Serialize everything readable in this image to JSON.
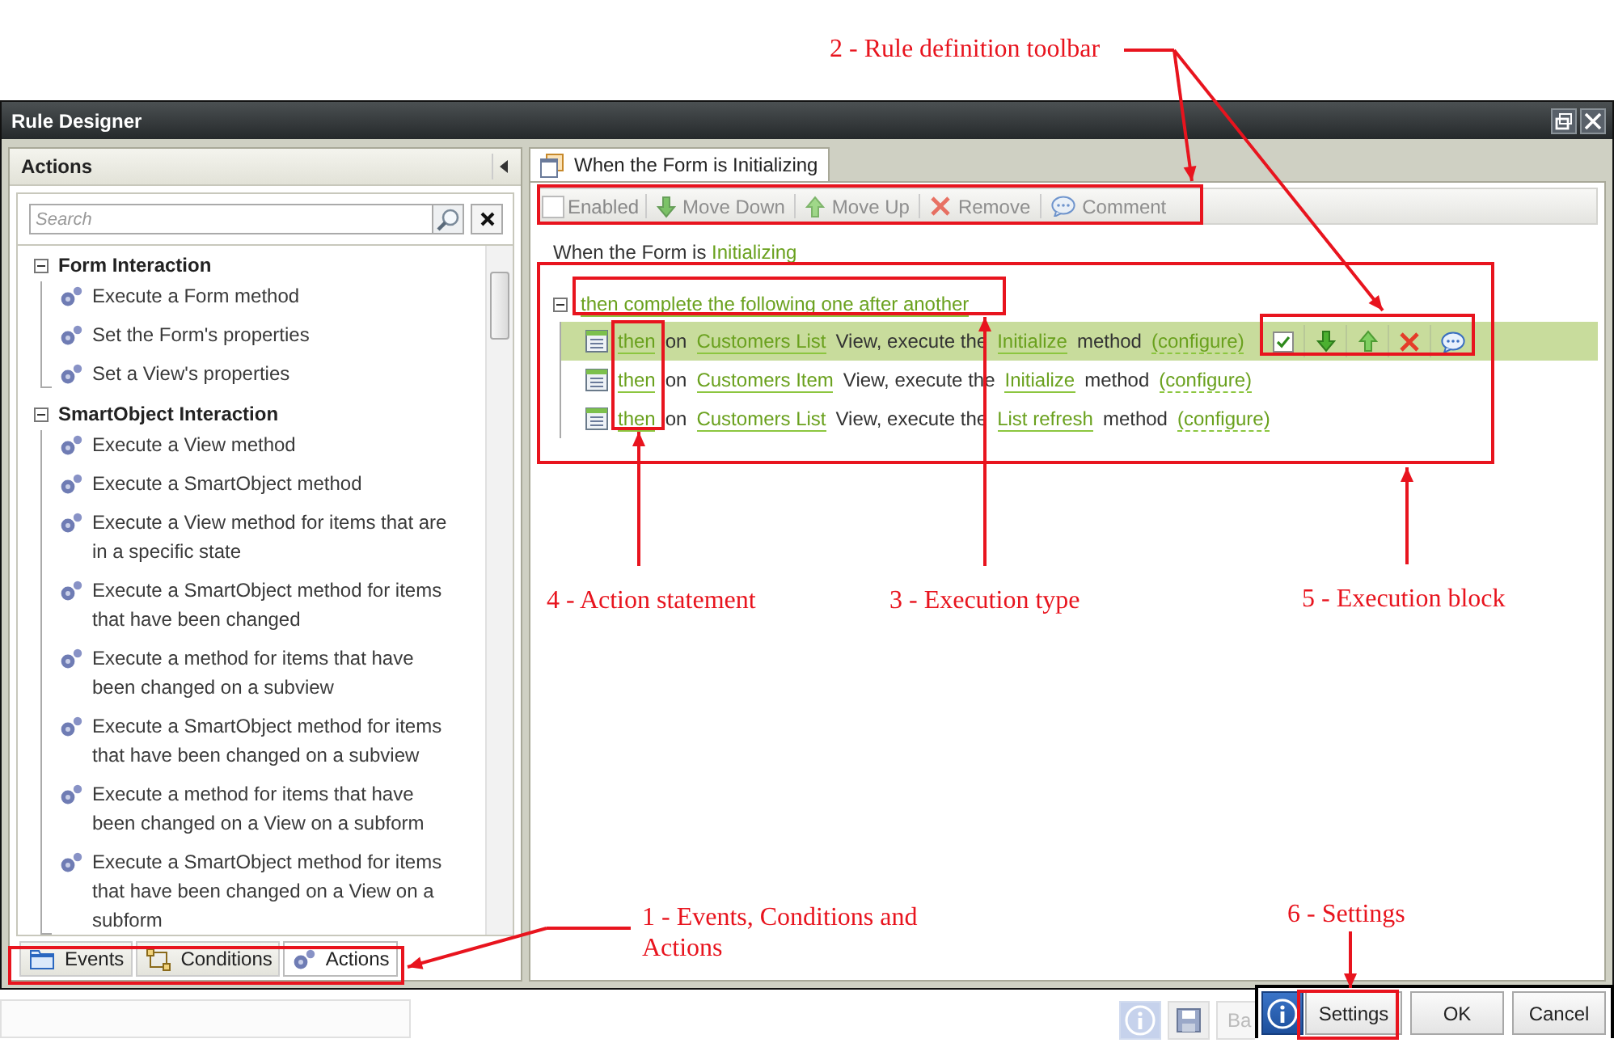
{
  "window": {
    "title": "Rule Designer"
  },
  "left_panel": {
    "title": "Actions",
    "search": {
      "placeholder": "Search"
    },
    "groups": [
      {
        "label": "Form Interaction",
        "expanded": true,
        "children": [
          {
            "label": "Execute a Form method"
          },
          {
            "label": "Set the Form's properties"
          },
          {
            "label": "Set a View's properties"
          }
        ]
      },
      {
        "label": "SmartObject Interaction",
        "expanded": true,
        "children": [
          {
            "label": "Execute a View method"
          },
          {
            "label": "Execute a SmartObject method"
          },
          {
            "label": "Execute a View method for items that are in a specific state"
          },
          {
            "label": "Execute a SmartObject method for items that have been changed"
          },
          {
            "label": "Execute a method for items that have been changed on a subview"
          },
          {
            "label": "Execute a SmartObject method for items that have been changed on a subview"
          },
          {
            "label": "Execute a method for items that have been changed on a View on a subform"
          },
          {
            "label": "Execute a SmartObject method for items that have been changed on a View on a subform"
          }
        ]
      }
    ],
    "tabs": [
      {
        "label": "Events",
        "kind": "events",
        "selected": false
      },
      {
        "label": "Conditions",
        "kind": "conditions",
        "selected": false
      },
      {
        "label": "Actions",
        "kind": "actions",
        "selected": true
      }
    ]
  },
  "rule_tab": {
    "label": "When the Form is Initializing"
  },
  "toolbar": {
    "enabled": {
      "label": "Enabled",
      "checked": false
    },
    "buttons": [
      {
        "label": "Move Down",
        "kind": "down",
        "disabled": true
      },
      {
        "label": "Move Up",
        "kind": "up",
        "disabled": true
      },
      {
        "label": "Remove",
        "kind": "remove",
        "disabled": true
      },
      {
        "label": "Comment",
        "kind": "comment",
        "disabled": true
      }
    ]
  },
  "rule_heading": {
    "text": "When the Form is",
    "event": "Initializing"
  },
  "execution": {
    "label": "then complete the following one after another",
    "expanded": true,
    "actions": [
      {
        "keyword": "then",
        "on": "on",
        "view": "Customers List",
        "middle": "View, execute the",
        "method": "Initialize",
        "after": "method",
        "configure": "(configure)",
        "selected": true
      },
      {
        "keyword": "then",
        "on": "on",
        "view": "Customers Item",
        "middle": "View, execute the",
        "method": "Initialize",
        "after": "method",
        "configure": "(configure)",
        "selected": false
      },
      {
        "keyword": "then",
        "on": "on",
        "view": "Customers List",
        "middle": "View, execute the",
        "method": "List refresh",
        "after": "method",
        "configure": "(configure)",
        "selected": false
      }
    ]
  },
  "background_button": {
    "label": "Ba"
  },
  "footer": {
    "buttons": [
      {
        "label": "Settings"
      },
      {
        "label": "OK"
      },
      {
        "label": "Cancel"
      }
    ]
  },
  "annotations": [
    {
      "text": "2 - Rule definition toolbar"
    },
    {
      "text": "4 - Action statement"
    },
    {
      "text": "3 - Execution type"
    },
    {
      "text": "5 - Execution block"
    },
    {
      "text": "1 - Events, Conditions and Actions"
    },
    {
      "text": "6 - Settings"
    }
  ]
}
